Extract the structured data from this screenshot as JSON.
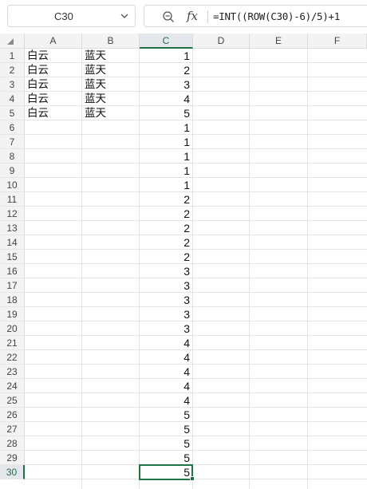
{
  "formula_bar": {
    "name_box": "C30",
    "fx_label": "fx",
    "formula": "=INT((ROW(C30)-6)/5)+1"
  },
  "icons": {
    "name_box_dropdown": "chevron-down-icon",
    "zoom": "zoom-icon",
    "corner": "select-all-triangle-icon"
  },
  "colors": {
    "selection_green": "#217346",
    "header_bg": "#f3f3f3",
    "gridline": "#e4e4e4"
  },
  "columns": [
    "A",
    "B",
    "C",
    "D",
    "E",
    "F"
  ],
  "selected_column": "C",
  "selected_row": 30,
  "rows": [
    {
      "num": "1",
      "a": "白云",
      "b": "蓝天",
      "c": "1"
    },
    {
      "num": "2",
      "a": "白云",
      "b": "蓝天",
      "c": "2"
    },
    {
      "num": "3",
      "a": "白云",
      "b": "蓝天",
      "c": "3"
    },
    {
      "num": "4",
      "a": "白云",
      "b": "蓝天",
      "c": "4"
    },
    {
      "num": "5",
      "a": "白云",
      "b": "蓝天",
      "c": "5"
    },
    {
      "num": "6",
      "a": "",
      "b": "",
      "c": "1"
    },
    {
      "num": "7",
      "a": "",
      "b": "",
      "c": "1"
    },
    {
      "num": "8",
      "a": "",
      "b": "",
      "c": "1"
    },
    {
      "num": "9",
      "a": "",
      "b": "",
      "c": "1"
    },
    {
      "num": "10",
      "a": "",
      "b": "",
      "c": "1"
    },
    {
      "num": "11",
      "a": "",
      "b": "",
      "c": "2"
    },
    {
      "num": "12",
      "a": "",
      "b": "",
      "c": "2"
    },
    {
      "num": "13",
      "a": "",
      "b": "",
      "c": "2"
    },
    {
      "num": "14",
      "a": "",
      "b": "",
      "c": "2"
    },
    {
      "num": "15",
      "a": "",
      "b": "",
      "c": "2"
    },
    {
      "num": "16",
      "a": "",
      "b": "",
      "c": "3"
    },
    {
      "num": "17",
      "a": "",
      "b": "",
      "c": "3"
    },
    {
      "num": "18",
      "a": "",
      "b": "",
      "c": "3"
    },
    {
      "num": "19",
      "a": "",
      "b": "",
      "c": "3"
    },
    {
      "num": "20",
      "a": "",
      "b": "",
      "c": "3"
    },
    {
      "num": "21",
      "a": "",
      "b": "",
      "c": "4"
    },
    {
      "num": "22",
      "a": "",
      "b": "",
      "c": "4"
    },
    {
      "num": "23",
      "a": "",
      "b": "",
      "c": "4"
    },
    {
      "num": "24",
      "a": "",
      "b": "",
      "c": "4"
    },
    {
      "num": "25",
      "a": "",
      "b": "",
      "c": "4"
    },
    {
      "num": "26",
      "a": "",
      "b": "",
      "c": "5"
    },
    {
      "num": "27",
      "a": "",
      "b": "",
      "c": "5"
    },
    {
      "num": "28",
      "a": "",
      "b": "",
      "c": "5"
    },
    {
      "num": "29",
      "a": "",
      "b": "",
      "c": "5"
    },
    {
      "num": "30",
      "a": "",
      "b": "",
      "c": "5"
    }
  ]
}
